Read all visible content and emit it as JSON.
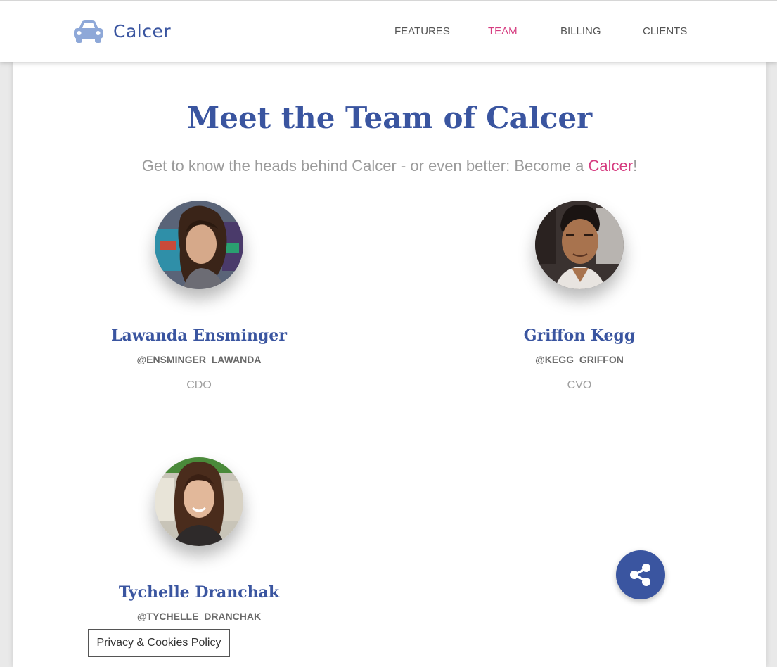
{
  "header": {
    "brand_name": "Calcer",
    "brand_icon": "car-icon",
    "nav": [
      {
        "label": "FEATURES",
        "active": false
      },
      {
        "label": "TEAM",
        "active": true
      },
      {
        "label": "BILLING",
        "active": false
      },
      {
        "label": "CLIENTS",
        "active": false
      }
    ]
  },
  "main": {
    "title": "Meet the Team of Calcer",
    "subtitle_prefix": "Get to know the heads behind Calcer - or even better: Become a ",
    "subtitle_accent": "Calcer",
    "subtitle_suffix": "!",
    "members": [
      {
        "name": "Lawanda Ensminger",
        "handle": "@ENSMINGER_LAWANDA",
        "role": "CDO"
      },
      {
        "name": "Griffon Kegg",
        "handle": "@KEGG_GRIFFON",
        "role": "CVO"
      },
      {
        "name": "Tychelle Dranchak",
        "handle": "@TYCHELLE_DRANCHAK",
        "role": ""
      }
    ]
  },
  "share_button": {
    "icon": "share-icon"
  },
  "cookie_policy": {
    "label": "Privacy & Cookies Policy"
  },
  "colors": {
    "brand": "#3a55a0",
    "accent": "#d63c80",
    "muted_text": "#9b9b9b"
  }
}
